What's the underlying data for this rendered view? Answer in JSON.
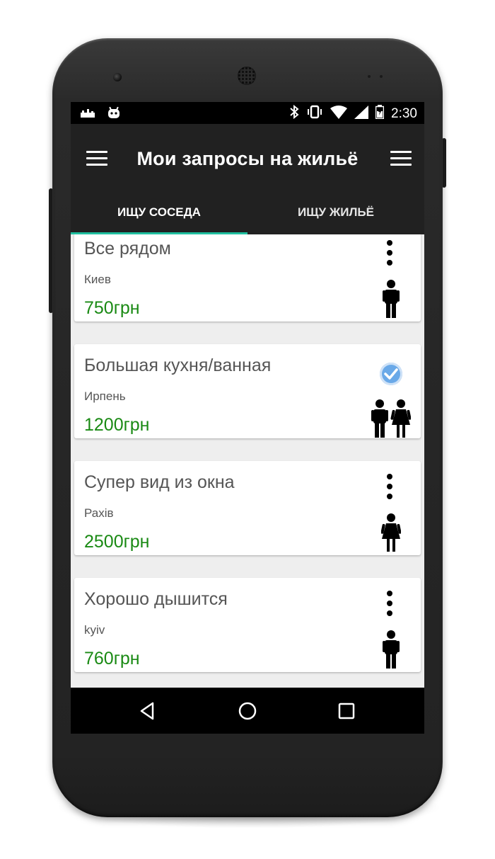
{
  "statusbar": {
    "time": "2:30",
    "left_icons": [
      "notification-icon",
      "android-icon"
    ],
    "right_icons": [
      "bluetooth-icon",
      "vibrate-icon",
      "wifi-icon",
      "signal-icon",
      "battery-icon"
    ]
  },
  "appbar": {
    "title": "Мои запросы на жильё",
    "left_icon": "menu-icon",
    "right_icon": "menu-icon"
  },
  "tabs": [
    {
      "label": "ИЩУ СОСЕДА",
      "active": true
    },
    {
      "label": "ИЩУ ЖИЛЬЁ",
      "active": false
    }
  ],
  "accent_color": "#1fbf9f",
  "price_color": "#1a8a14",
  "listings": [
    {
      "title": "Все рядом",
      "city": "Киев",
      "price": "750грн",
      "action_icon": "more-vert-icon",
      "gender_icon": "male-icon"
    },
    {
      "title": "Большая кухня/ванная",
      "city": "Ирпень",
      "price": "1200грн",
      "action_icon": "check-circle-icon",
      "gender_icon": "male-female-icon"
    },
    {
      "title": "Супер вид из окна",
      "city": "Рахів",
      "price": "2500грн",
      "action_icon": "more-vert-icon",
      "gender_icon": "female-icon"
    },
    {
      "title": "Хорошо дышится",
      "city": "kyiv",
      "price": "760грн",
      "action_icon": "more-vert-icon",
      "gender_icon": "male-icon"
    }
  ],
  "navbar": [
    "back-icon",
    "home-icon",
    "recent-apps-icon"
  ]
}
